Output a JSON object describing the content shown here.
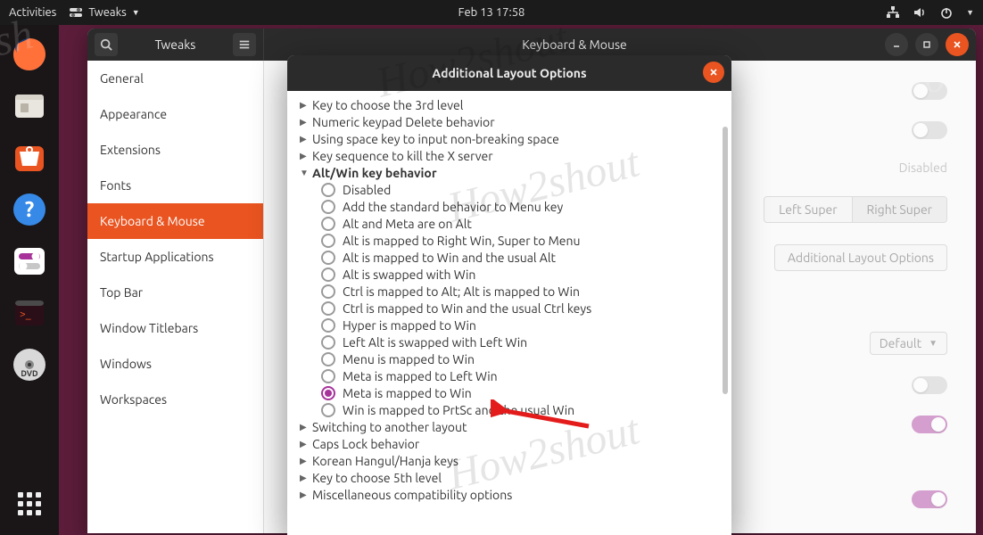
{
  "panel": {
    "activities": "Activities",
    "appmenu": "Tweaks",
    "clock": "Feb 13  17:58"
  },
  "window": {
    "left_title": "Tweaks",
    "center_title": "Keyboard & Mouse"
  },
  "sidebar": {
    "items": [
      {
        "label": "General"
      },
      {
        "label": "Appearance"
      },
      {
        "label": "Extensions"
      },
      {
        "label": "Fonts"
      },
      {
        "label": "Keyboard & Mouse",
        "active": true
      },
      {
        "label": "Startup Applications"
      },
      {
        "label": "Top Bar"
      },
      {
        "label": "Window Titlebars"
      },
      {
        "label": "Windows"
      },
      {
        "label": "Workspaces"
      }
    ]
  },
  "main": {
    "status_disabled": "Disabled",
    "super_left": "Left Super",
    "super_right": "Right Super",
    "alo_button": "Additional Layout Options",
    "accel_default": "Default"
  },
  "modal": {
    "title": "Additional Layout Options",
    "groups_before": [
      "Key to choose the 3rd level",
      "Numeric keypad Delete behavior",
      "Using space key to input non-breaking space",
      "Key sequence to kill the X server"
    ],
    "expanded_group": "Alt/Win key behavior",
    "options": [
      "Disabled",
      "Add the standard behavior to Menu key",
      "Alt and Meta are on Alt",
      "Alt is mapped to Right Win, Super to Menu",
      "Alt is mapped to Win and the usual Alt",
      "Alt is swapped with Win",
      "Ctrl is mapped to Alt; Alt is mapped to Win",
      "Ctrl is mapped to Win and the usual Ctrl keys",
      "Hyper is mapped to Win",
      "Left Alt is swapped with Left Win",
      "Menu is mapped to Win",
      "Meta is mapped to Left Win",
      "Meta is mapped to Win",
      "Win is mapped to PrtSc and the usual Win"
    ],
    "selected_index": 12,
    "groups_after": [
      "Switching to another layout",
      "Caps Lock behavior",
      "Korean Hangul/Hanja keys",
      "Key to choose 5th level",
      "Miscellaneous compatibility options"
    ]
  }
}
